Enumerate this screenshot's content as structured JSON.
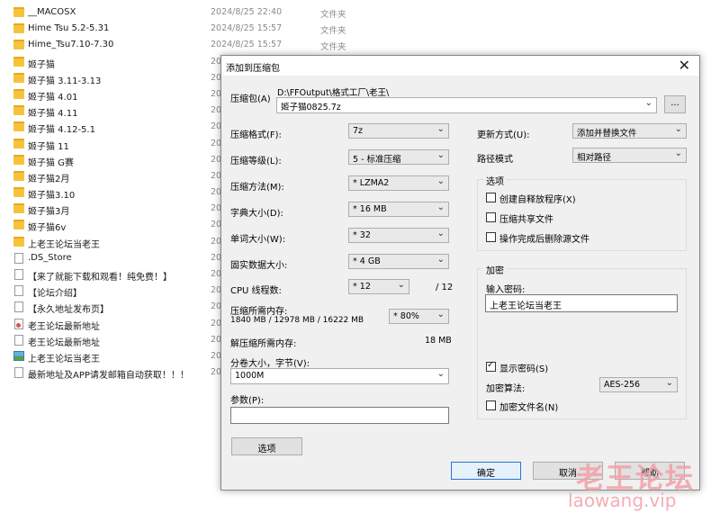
{
  "explorer": {
    "files": [
      {
        "name": "__MACOSX",
        "date": "2024/8/25 22:40",
        "type": "文件夹",
        "icon": "folder-icon"
      },
      {
        "name": "Hime Tsu 5.2-5.31",
        "date": "2024/8/25 15:57",
        "type": "文件夹",
        "icon": "folder-icon"
      },
      {
        "name": "Hime_Tsu7.10-7.30",
        "date": "2024/8/25 15:57",
        "type": "文件夹",
        "icon": "folder-icon"
      },
      {
        "name": "姬子猫",
        "date": "20",
        "type": "",
        "icon": "folder-icon"
      },
      {
        "name": "姬子猫 3.11-3.13",
        "date": "20",
        "type": "",
        "icon": "folder-icon"
      },
      {
        "name": "姬子猫 4.01",
        "date": "20",
        "type": "",
        "icon": "folder-icon"
      },
      {
        "name": "姬子猫 4.11",
        "date": "20",
        "type": "",
        "icon": "folder-icon"
      },
      {
        "name": "姬子猫 4.12-5.1",
        "date": "20",
        "type": "",
        "icon": "folder-icon"
      },
      {
        "name": "姬子猫 11",
        "date": "20",
        "type": "",
        "icon": "folder-icon"
      },
      {
        "name": "姬子猫 G赛",
        "date": "20",
        "type": "",
        "icon": "folder-icon"
      },
      {
        "name": "姬子猫2月",
        "date": "20",
        "type": "",
        "icon": "folder-icon"
      },
      {
        "name": "姬子猫3.10",
        "date": "20",
        "type": "",
        "icon": "folder-icon"
      },
      {
        "name": "姬子猫3月",
        "date": "20",
        "type": "",
        "icon": "folder-icon"
      },
      {
        "name": "姬子猫6v",
        "date": "20",
        "type": "",
        "icon": "folder-icon"
      },
      {
        "name": "上老王论坛当老王",
        "date": "20",
        "type": "",
        "icon": "folder-icon"
      },
      {
        "name": ".DS_Store",
        "date": "20",
        "type": "",
        "icon": "doc-icon"
      },
      {
        "name": "【来了就能下载和观看！纯免费！】",
        "date": "20",
        "type": "",
        "icon": "doc-icon"
      },
      {
        "name": "【论坛介绍】",
        "date": "20",
        "type": "",
        "icon": "doc-icon"
      },
      {
        "name": "【永久地址发布页】",
        "date": "20",
        "type": "",
        "icon": "doc-icon"
      },
      {
        "name": "老王论坛最新地址",
        "date": "20",
        "type": "",
        "icon": "html-icon"
      },
      {
        "name": "老王论坛最新地址",
        "date": "20",
        "type": "",
        "icon": "doc-icon"
      },
      {
        "name": "上老王论坛当老王",
        "date": "20",
        "type": "",
        "icon": "image-icon"
      },
      {
        "name": "最新地址及APP请发邮箱自动获取！！！",
        "date": "20",
        "type": "",
        "icon": "doc-icon"
      }
    ]
  },
  "dialog": {
    "title": "添加到压缩包",
    "close_glyph": "✕",
    "archive_label": "压缩包(A)",
    "archive_path": "D:\\FFOutput\\格式工厂\\老王\\",
    "archive_name": "姬子猫0825.7z",
    "browse_label": "...",
    "format_label": "压缩格式(F):",
    "format_value": "7z",
    "level_label": "压缩等级(L):",
    "level_value": "5 - 标准压缩",
    "method_label": "压缩方法(M):",
    "method_value": "* LZMA2",
    "dict_label": "字典大小(D):",
    "dict_value": "* 16 MB",
    "word_label": "单词大小(W):",
    "word_value": "* 32",
    "solid_label": "固实数据大小:",
    "solid_value": "* 4 GB",
    "threads_label": "CPU 线程数:",
    "threads_value": "* 12",
    "threads_max": "/ 12",
    "mem_comp_label": "压缩所需内存:",
    "mem_comp_value": "1840 MB / 12978 MB / 16222 MB",
    "mem_percent": "* 80%",
    "mem_decomp_label": "解压缩所需内存:",
    "mem_decomp_value": "18 MB",
    "split_label": "分卷大小，字节(V):",
    "split_value": "1000M",
    "params_label": "参数(P):",
    "params_value": "",
    "options_button": "选项",
    "update_label": "更新方式(U):",
    "update_value": "添加并替换文件",
    "path_label": "路径模式",
    "path_value": "相对路径",
    "options_group": "选项",
    "opt_sfx": "创建自释放程序(X)",
    "opt_shared": "压缩共享文件",
    "opt_delete": "操作完成后删除源文件",
    "encrypt_group": "加密",
    "password_label": "输入密码:",
    "password_value": "上老王论坛当老王",
    "show_password_label": "显示密码(S)",
    "enc_method_label": "加密算法:",
    "enc_method_value": "AES-256",
    "enc_names_label": "加密文件名(N)",
    "ok_label": "确定",
    "cancel_label": "取消",
    "help_label": "帮助"
  },
  "watermark": {
    "cn": "老王论坛",
    "en": "laowang.vip"
  }
}
